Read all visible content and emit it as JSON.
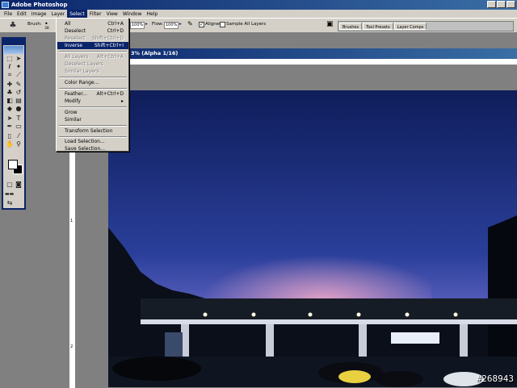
{
  "app": {
    "title": "Adobe Photoshop"
  },
  "menubar": [
    "File",
    "Edit",
    "Image",
    "Layer",
    "Select",
    "Filter",
    "View",
    "Window",
    "Help"
  ],
  "options": {
    "brush_label": "Brush:",
    "brush_size": "38",
    "opacity_value": "100%",
    "flow_label": "Flow:",
    "flow_value": "100%",
    "aligned_label": "Aligned",
    "sample_all_label": "Sample All Layers"
  },
  "palette_well": [
    "Brushes",
    "Tool Presets",
    "Layer Comps"
  ],
  "document": {
    "title": "3% (Alpha 1/16)",
    "ruler_marks": [
      "1",
      "2"
    ]
  },
  "select_menu": {
    "items": [
      {
        "label": "All",
        "shortcut": "Ctrl+A"
      },
      {
        "label": "Deselect",
        "shortcut": "Ctrl+D"
      },
      {
        "label": "Reselect",
        "shortcut": "Shift+Ctrl+D"
      },
      {
        "label": "Inverse",
        "shortcut": "Shift+Ctrl+I"
      },
      {
        "label": "All Layers",
        "shortcut": "Alt+Ctrl+A"
      },
      {
        "label": "Deselect Layers",
        "shortcut": ""
      },
      {
        "label": "Similar Layers",
        "shortcut": ""
      },
      {
        "label": "Color Range...",
        "shortcut": ""
      },
      {
        "label": "Feather...",
        "shortcut": "Alt+Ctrl+D"
      },
      {
        "label": "Modify",
        "shortcut": "▸"
      },
      {
        "label": "Grow",
        "shortcut": ""
      },
      {
        "label": "Similar",
        "shortcut": ""
      },
      {
        "label": "Transform Selection",
        "shortcut": ""
      },
      {
        "label": "Load Selection...",
        "shortcut": ""
      },
      {
        "label": "Save Selection...",
        "shortcut": ""
      }
    ]
  },
  "watermark": "#268943",
  "colors": {
    "title_blue": "#0a246a",
    "chrome": "#d4d0c8",
    "sky_top": "#1a2a6e",
    "sky_bottom": "#c08ac8"
  }
}
